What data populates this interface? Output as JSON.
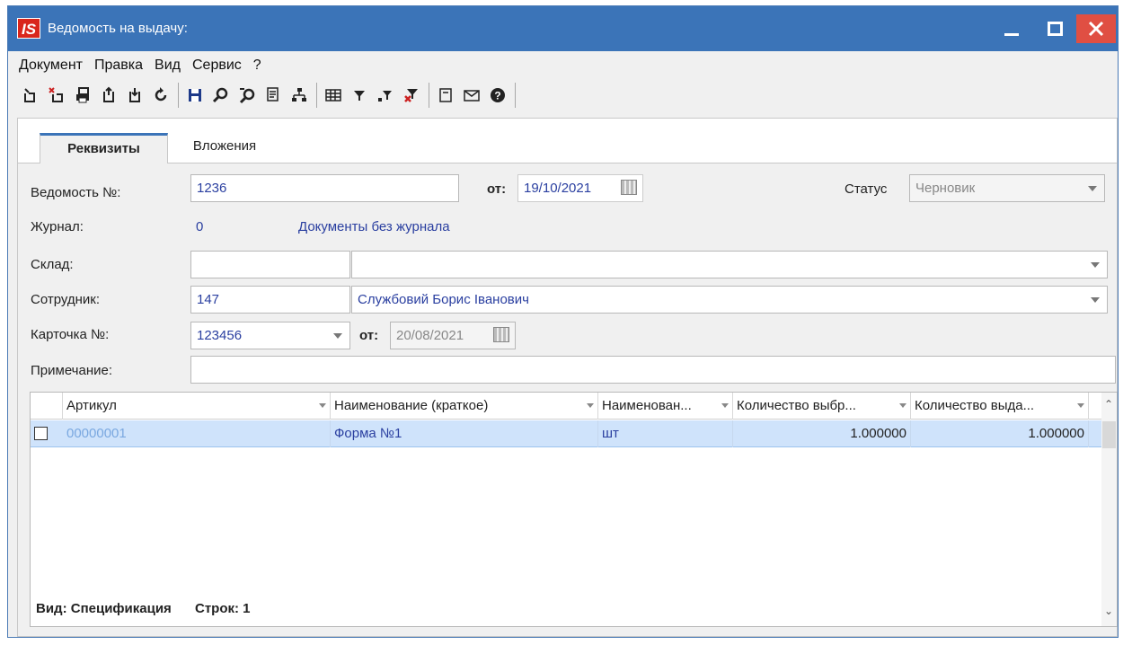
{
  "window": {
    "icon_text": "IS",
    "title": "Ведомость на выдачу:"
  },
  "menu": [
    "Документ",
    "Правка",
    "Вид",
    "Сервис",
    "?"
  ],
  "toolbar_icons": [
    "create-icon",
    "create-copy-icon",
    "print-icon",
    "doc-up-icon",
    "doc-down-icon",
    "refresh-icon",
    "save-icon",
    "find-icon",
    "find-next-icon",
    "report-icon",
    "tree-icon",
    "grid-icon",
    "filter-icon",
    "filter-add-icon",
    "filter-clear-icon",
    "form-icon",
    "mail-icon",
    "help-icon"
  ],
  "tabs": [
    {
      "label": "Реквизиты",
      "active": true
    },
    {
      "label": "Вложения",
      "active": false
    }
  ],
  "form": {
    "vedomost_label": "Ведомость №:",
    "vedomost_value": "1236",
    "date_label": "от:",
    "date_value": "19/10/2021",
    "status_label": "Статус",
    "status_value": "Черновик",
    "journal_label": "Журнал:",
    "journal_code": "0",
    "journal_name": "Документы без журнала",
    "sklad_label": "Склад:",
    "sklad_code": "",
    "sklad_name": "",
    "sotrudnik_label": "Сотрудник:",
    "sotrudnik_code": "147",
    "sotrudnik_name": "Службовий Борис Іванович",
    "kartochka_label": "Карточка №:",
    "kartochka_value": "123456",
    "kartochka_date_label": "от:",
    "kartochka_date_value": "20/08/2021",
    "primechanie_label": "Примечание:",
    "primechanie_value": ""
  },
  "grid": {
    "columns": [
      "Артикул",
      "Наименование (краткое)",
      "Наименован...",
      "Количество выбр...",
      "Количество выда..."
    ],
    "rows": [
      {
        "articul": "00000001",
        "name": "Форма №1",
        "unit": "шт",
        "qty_selected": "1.000000",
        "qty_issued": "1.000000"
      }
    ],
    "footer_view": "Вид: Спецификация",
    "footer_rows": "Строк: 1"
  },
  "colors": {
    "titlebar": "#3b74b8",
    "close_button": "#e04f43",
    "selected_row": "#cfe3fb",
    "value_text": "#2a3fa0"
  }
}
